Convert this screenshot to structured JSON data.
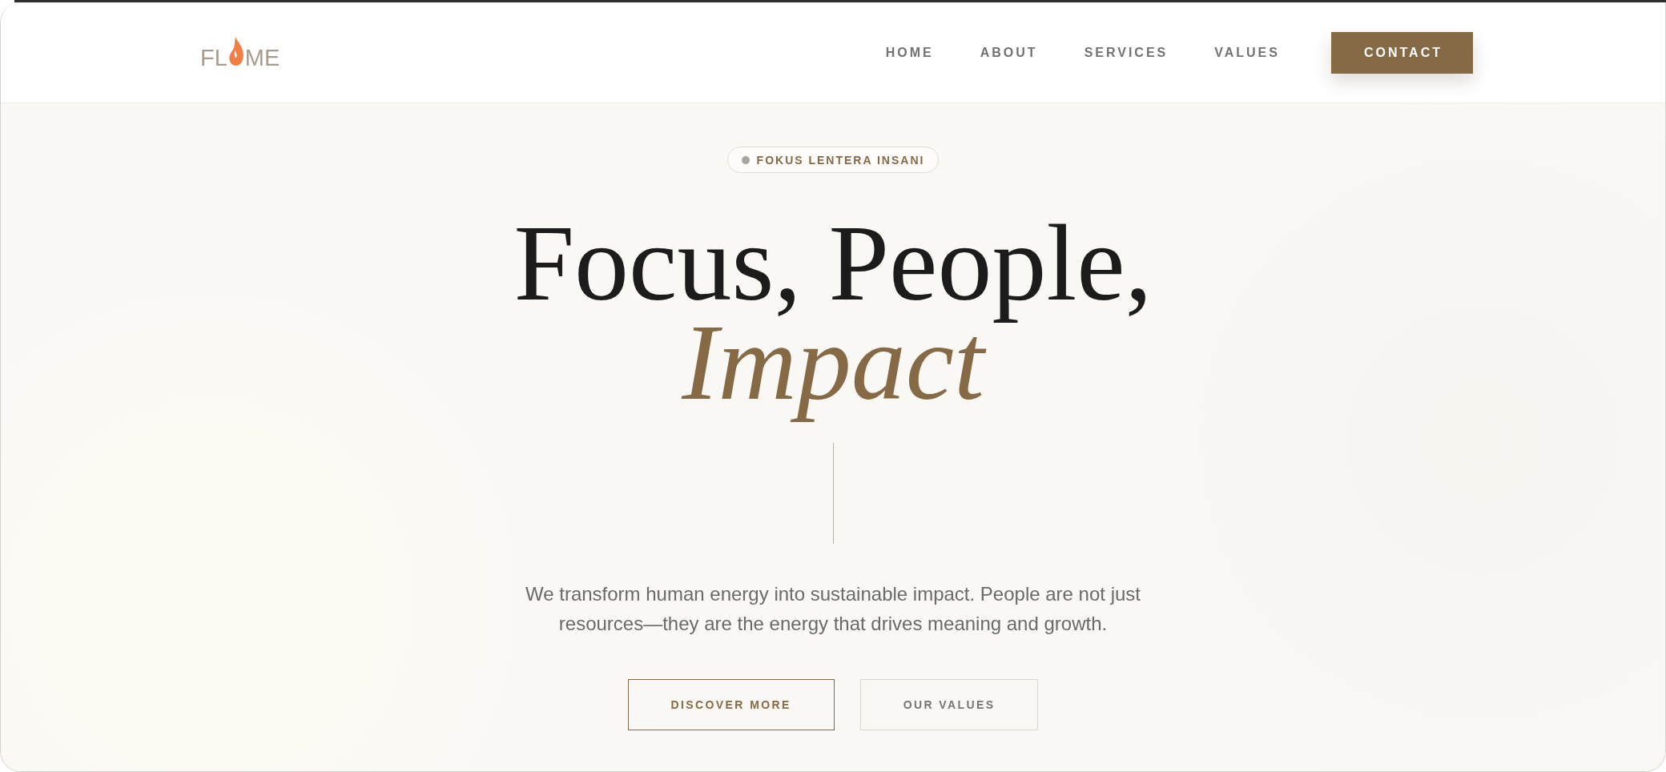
{
  "logo": {
    "text_before_flame": "FL",
    "text_after_flame": "ME"
  },
  "nav": [
    {
      "label": "HOME",
      "kind": "link"
    },
    {
      "label": "ABOUT",
      "kind": "link"
    },
    {
      "label": "SERVICES",
      "kind": "link"
    },
    {
      "label": "VALUES",
      "kind": "link"
    },
    {
      "label": "CONTACT",
      "kind": "button"
    }
  ],
  "hero": {
    "badge": "FOKUS LENTERA INSANI",
    "title": "Focus, People, *Impact*",
    "description": "We transform human energy into sustainable impact. People are not just resources—they are the energy that drives meaning and growth.",
    "buttons": [
      {
        "label": "DISCOVER MORE",
        "kind": "primary"
      },
      {
        "label": "OUR VALUES",
        "kind": "secondary"
      }
    ]
  }
}
